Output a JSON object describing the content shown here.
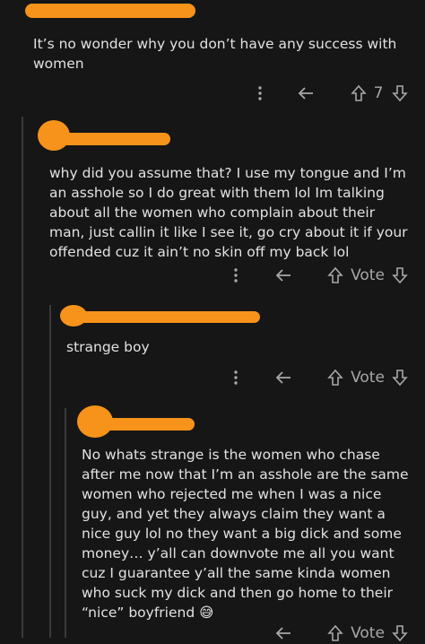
{
  "comments": [
    {
      "text": "It’s no wonder why you don’t have any success with women",
      "score": "7"
    },
    {
      "text": "why did you assume that? I use my tongue and I’m an asshole so I do great with them lol Im talking about all the women who complain about their man, just callin it like I see it, go cry about it if your offended cuz it ain’t no skin off my back lol",
      "score": "Vote"
    },
    {
      "text": "strange boy",
      "score": "Vote"
    },
    {
      "text": "No whats strange is the women who chase after me now that I’m an asshole are the same women who rejected me when I was a nice guy, and yet they always claim they want a nice guy lol no they want a big dick and some money… y’all can downvote me all you want cuz I guarantee y’all the same kinda women who suck my dick and then go home to their “nice” boyfriend 😅",
      "score": "Vote"
    }
  ],
  "colors": {
    "redaction": "#f7931a",
    "background": "#161616"
  }
}
